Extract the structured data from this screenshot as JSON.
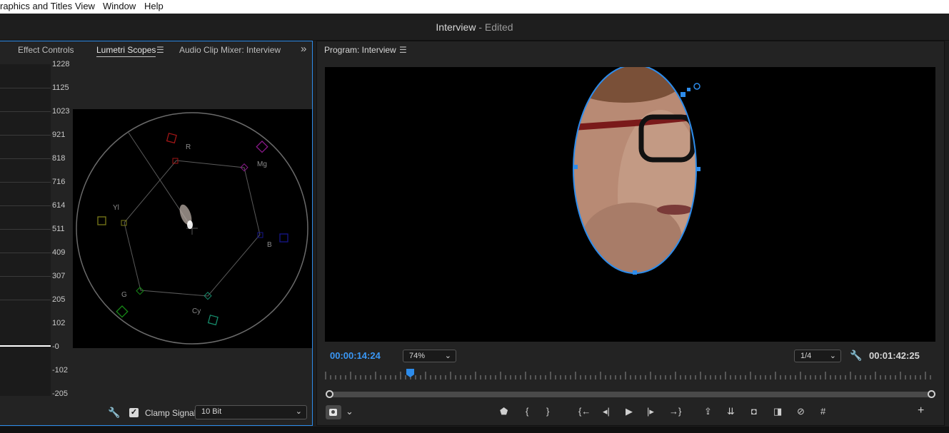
{
  "menu": {
    "items": [
      "raphics and Titles",
      "View",
      "Window",
      "Help"
    ]
  },
  "title": {
    "name": "Interview",
    "status": "- Edited"
  },
  "left_panel": {
    "tabs": [
      "Effect Controls",
      "Lumetri Scopes",
      "Audio Clip Mixer: Interview"
    ],
    "more_icon": "double-chevron-right",
    "scale_labels": [
      "1228",
      "1125",
      "1023",
      "921",
      "818",
      "716",
      "614",
      "511",
      "409",
      "307",
      "205",
      "102",
      "-0",
      "-102",
      "-205"
    ],
    "vectorscope_targets": [
      "R",
      "Mg",
      "Yl",
      "B",
      "G",
      "Cy"
    ],
    "clamp_label": "Clamp Signal",
    "clamp_checked": true,
    "bit_depth": "10 Bit"
  },
  "program": {
    "tab": "Program: Interview",
    "timecode_current": "00:00:14:24",
    "zoom": "74%",
    "resolution": "1/4",
    "timecode_duration": "00:01:42:25",
    "colors": {
      "accent": "#2d8ceb",
      "timecode": "#3a97f5"
    }
  },
  "transport": {
    "icons": [
      "add-marker-icon",
      "mark-in-icon",
      "mark-out-icon",
      "go-to-in-icon",
      "step-back-icon",
      "play-icon",
      "step-forward-icon",
      "go-to-out-icon",
      "lift-icon",
      "extract-icon",
      "export-frame-icon",
      "comparison-view-icon",
      "toggle-proxies-icon",
      "safe-margins-icon",
      "button-editor-icon"
    ],
    "glyphs": {
      "marker": "⬟",
      "in": "{",
      "out": "}",
      "goin": "{←",
      "stepback": "◂|",
      "play": "▶",
      "stepfwd": "|▸",
      "goout": "→}",
      "lift": "⇪",
      "extract": "⇊",
      "camera": "◘",
      "compare": "◨",
      "proxy": "⊘",
      "grid": "#",
      "plus": "+",
      "wrench": "🔧",
      "chev": "⌄",
      "dblchev": "»",
      "check": "✓",
      "ham": "☰"
    }
  }
}
